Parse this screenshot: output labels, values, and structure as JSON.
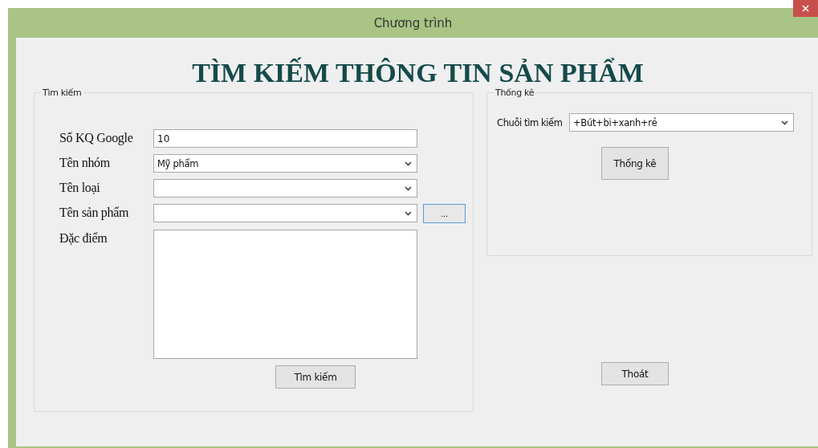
{
  "window": {
    "title": "Chương trình"
  },
  "heading": "TÌM KIẾM THÔNG TIN SẢN PHẨM",
  "search_group": {
    "legend": "Tìm kiếm",
    "fields": [
      {
        "kind": "text",
        "label": "Số KQ Google",
        "value": "10"
      },
      {
        "kind": "combo",
        "label": "Tên nhóm",
        "value": "Mỹ phẩm"
      },
      {
        "kind": "combo",
        "label": "Tên loại"
      },
      {
        "kind": "combo",
        "label": "Tên sản phẩm",
        "browse_button": "..."
      },
      {
        "kind": "multiline",
        "label": "Đặc điểm"
      }
    ],
    "button": "Tìm kiếm"
  },
  "stats_group": {
    "legend": "Thống kê",
    "label": "Chuỗi tìm kiếm",
    "value": "+Bút+bi+xanh+rẻ",
    "button": "Thống kê"
  },
  "exit_button": "Thoát"
}
